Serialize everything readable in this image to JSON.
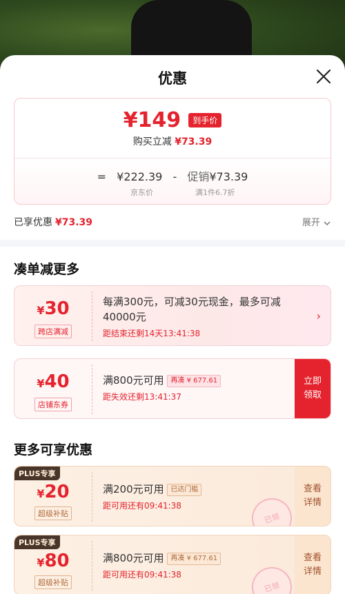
{
  "sheet": {
    "title": "优惠"
  },
  "price_card": {
    "price": "¥149",
    "price_tag": "到手价",
    "instant_label": "购买立减",
    "instant_value": "¥73.39",
    "formula_eq": "=",
    "formula_base": "¥222.39",
    "formula_minus": "-",
    "formula_promo_label": "促销",
    "formula_promo_value": "¥73.39",
    "base_caption": "京东价",
    "promo_caption": "满1件6.7折"
  },
  "enjoyed": {
    "label": "已享优惠",
    "value": "¥73.39",
    "expand_label": "展开"
  },
  "section1": {
    "title": "凑单减更多"
  },
  "coupon1": {
    "currency": "¥",
    "amount": "30",
    "tag": "跨店满减",
    "desc": "每满300元，可减30元现金，最多可减40000元",
    "time": "距结束还剩14天13:41:38"
  },
  "coupon2": {
    "currency": "¥",
    "amount": "40",
    "tag": "店铺东券",
    "desc": "满800元可用",
    "chip": "再凑 ¥ 677.61",
    "time": "距失效还剩13:41:37",
    "claim_label": "立即领取"
  },
  "section2": {
    "title": "更多可享优惠"
  },
  "coupon3": {
    "plus": "PLUS专享",
    "currency": "¥",
    "amount": "20",
    "tag": "超级补贴",
    "desc": "满200元可用",
    "chip": "已达门槛",
    "time": "距可用还有09:41:38",
    "detail_label": "查看详情",
    "stamp": "已领"
  },
  "coupon4": {
    "plus": "PLUS专享",
    "currency": "¥",
    "amount": "80",
    "tag": "超级补贴",
    "desc": "满800元可用",
    "chip": "再凑 ¥ 677.61",
    "time": "距可用还有09:41:38",
    "detail_label": "查看详情",
    "stamp": "已领"
  }
}
